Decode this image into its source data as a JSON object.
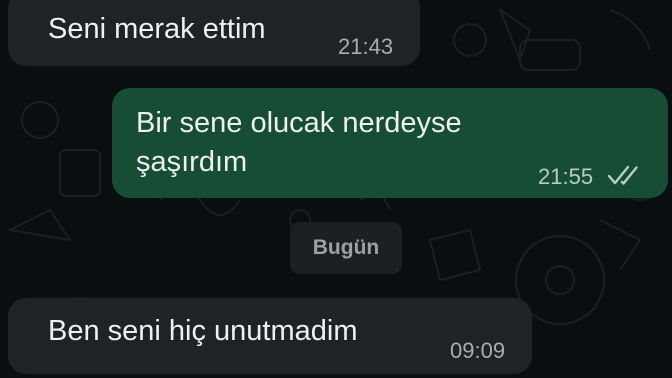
{
  "chat": {
    "messages": [
      {
        "direction": "incoming",
        "text": "Seni merak ettim",
        "time": "21:43"
      },
      {
        "direction": "outgoing",
        "lines": [
          "Bir sene olucak nerdeyse",
          "şaşırdım"
        ],
        "time": "21:55",
        "status": "read"
      },
      {
        "direction": "incoming",
        "text": "Ben seni hiç unutmadim",
        "time": "09:09"
      }
    ],
    "date_separator": "Bugün"
  },
  "theme": {
    "background": "#0b0e10",
    "incoming_bubble": "#1f2327",
    "outgoing_bubble": "#164d34",
    "read_ticks_color": "#b9cdc3"
  },
  "icons": {
    "read_receipt": "double-check-icon"
  }
}
